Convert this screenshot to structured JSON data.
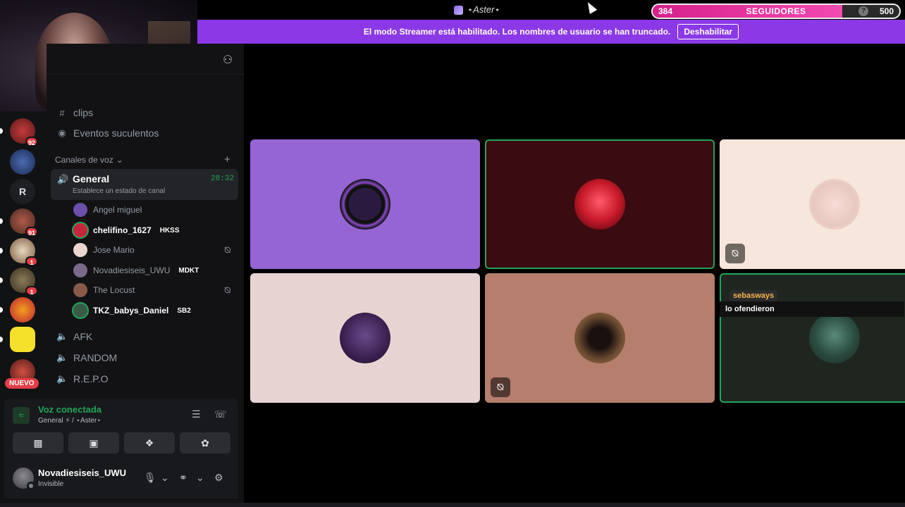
{
  "window": {
    "title": "⋆Aster⋆"
  },
  "goal": {
    "current": "384",
    "label": "SEGUIDORES",
    "target": "500",
    "progress_fraction": 0.768,
    "help": "?"
  },
  "banner": {
    "text": "El modo Streamer está habilitado. Los nombres de usuario se han truncado.",
    "button": "Deshabilitar"
  },
  "servers": [
    {
      "badge": "92"
    },
    {
      "badge": ""
    },
    {
      "letter": "R",
      "badge": ""
    },
    {
      "badge": "91"
    },
    {
      "badge": "1"
    },
    {
      "badge": "1"
    },
    {
      "badge": ""
    },
    {
      "badge": ""
    },
    {
      "badge": ""
    }
  ],
  "servers_new": "NUEVO",
  "channels": {
    "clips": "clips",
    "events": "Eventos suculentos",
    "voice_category": "Canales de voz",
    "general": {
      "name": "General",
      "status": "Establece un estado de canal",
      "time": "28:32"
    },
    "voice_users": [
      {
        "name": "Angel miguel",
        "tag": "",
        "muted": false,
        "speaking": false,
        "color": "#6b4fa8"
      },
      {
        "name": "chelifino_1627",
        "tag": "HKSS",
        "muted": false,
        "speaking": true,
        "color": "#c4283f"
      },
      {
        "name": "Jose Mario",
        "tag": "",
        "muted": true,
        "speaking": false,
        "color": "#e9d7cf"
      },
      {
        "name": "Novadiesiseis_UWU",
        "tag": "MDKT",
        "muted": false,
        "speaking": false,
        "color": "#7b6a8a"
      },
      {
        "name": "The Locust",
        "tag": "",
        "muted": true,
        "speaking": false,
        "color": "#8a5a48"
      },
      {
        "name": "TKZ_babys_Daniel",
        "tag": "SB2",
        "muted": false,
        "speaking": true,
        "color": "#3a5a48"
      }
    ],
    "other_voice": [
      "AFK",
      "RANDOM",
      "R.E.P.O"
    ]
  },
  "voice_panel": {
    "title": "Voz conectada",
    "subtitle": "General ⚡ / ⋆Aster⋆"
  },
  "user_panel": {
    "name": "Novadiesiseis_UWU",
    "status": "Invisible"
  },
  "stage": {
    "tiles": [
      {
        "bg": "#9565d4",
        "avatar": "avengers",
        "muted": false,
        "speaking": false
      },
      {
        "bg": "#3a0b10",
        "avatar": "red-char",
        "muted": false,
        "speaking": true
      },
      {
        "bg": "#f7e6dc",
        "avatar": "sketch",
        "muted": true,
        "speaking": false
      },
      {
        "bg": "#e7d3d1",
        "avatar": "anime",
        "muted": false,
        "speaking": false
      },
      {
        "bg": "#b67e6d",
        "avatar": "dark-figure",
        "muted": true,
        "speaking": false
      },
      {
        "bg": "#1f2620",
        "avatar": "green-figure",
        "muted": false,
        "speaking": true
      }
    ],
    "chat": {
      "user": "sebasways",
      "message": "lo ofendieron"
    }
  }
}
